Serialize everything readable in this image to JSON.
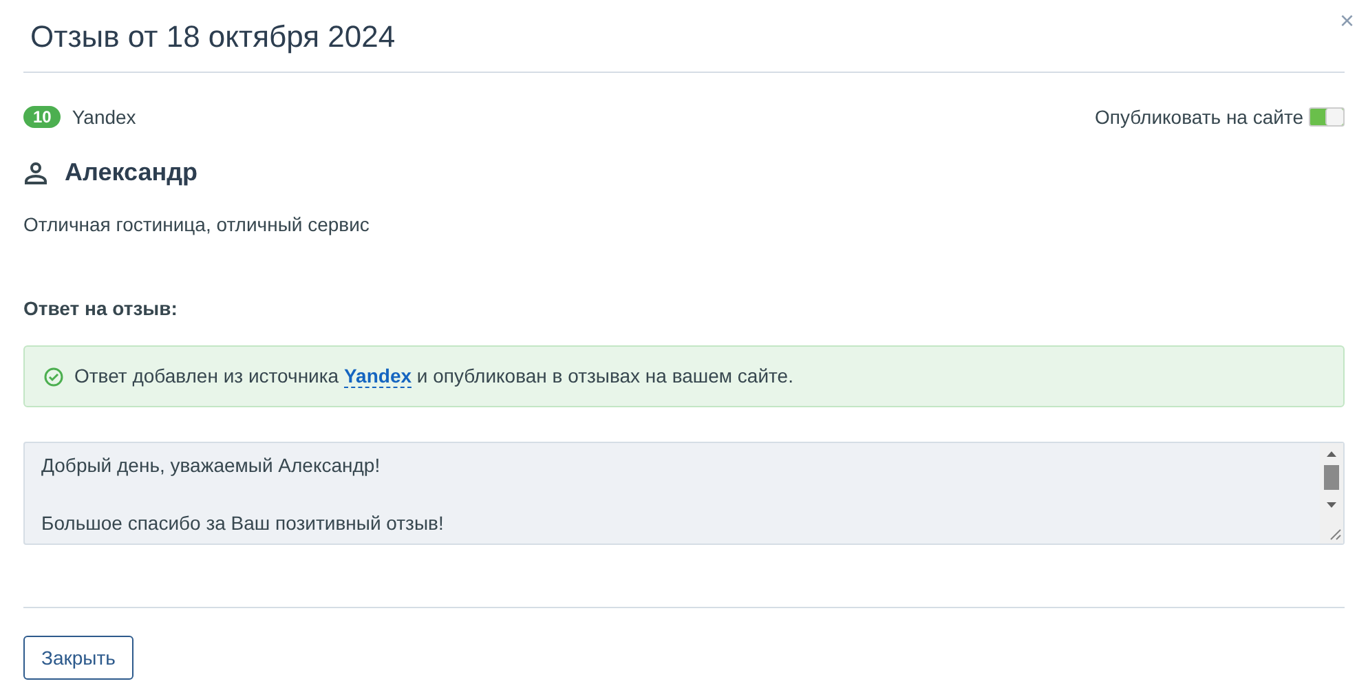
{
  "title": "Отзыв от 18 октября 2024",
  "close": "×",
  "rating": "10",
  "source": "Yandex",
  "publish": {
    "label": "Опубликовать на сайте",
    "on": true
  },
  "author": "Александр",
  "review": "Отличная гостиница, отличный сервис",
  "reply_heading": "Ответ на отзыв:",
  "notice": {
    "before": "Ответ добавлен из источника",
    "link": "Yandex",
    "after": "и опубликован в отзывах на вашем сайте."
  },
  "reply_paragraphs": [
    "Добрый день, уважаемый Александр!",
    "Большое спасибо за Ваш позитивный отзыв!"
  ],
  "buttons": [
    "Закрыть"
  ]
}
